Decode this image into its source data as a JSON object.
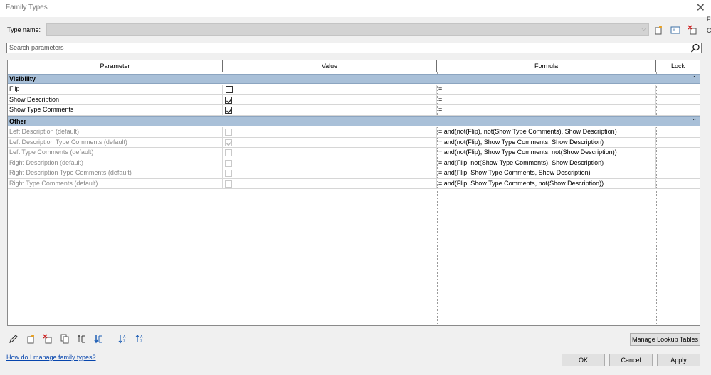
{
  "window": {
    "title": "Family Types",
    "edge_fragments": [
      "F",
      "C"
    ]
  },
  "type_name": {
    "label": "Type name:",
    "value": ""
  },
  "search": {
    "placeholder": "Search parameters"
  },
  "columns": {
    "parameter": "Parameter",
    "value": "Value",
    "formula": "Formula",
    "lock": "Lock"
  },
  "groups": [
    {
      "name": "Visibility",
      "collapse": "⌃",
      "rows": [
        {
          "param": "Flip",
          "checked": false,
          "disabled": false,
          "formula": "="
        },
        {
          "param": "Show Description",
          "checked": true,
          "disabled": false,
          "formula": "="
        },
        {
          "param": "Show Type Comments",
          "checked": true,
          "disabled": false,
          "formula": "="
        }
      ]
    },
    {
      "name": "Other",
      "collapse": "⌃",
      "rows": [
        {
          "param": "Left Description (default)",
          "checked": false,
          "disabled": true,
          "formula": "= and(not(Flip), not(Show Type Comments), Show Description)"
        },
        {
          "param": "Left Description Type Comments (default)",
          "checked": true,
          "disabled": true,
          "formula": "= and(not(Flip), Show Type Comments, Show Description)"
        },
        {
          "param": "Left Type Comments (default)",
          "checked": false,
          "disabled": true,
          "formula": "= and(not(Flip), Show Type Comments, not(Show Description))"
        },
        {
          "param": "Right Description (default)",
          "checked": false,
          "disabled": true,
          "formula": "= and(Flip, not(Show Type Comments), Show Description)"
        },
        {
          "param": "Right Description Type Comments (default)",
          "checked": false,
          "disabled": true,
          "formula": "= and(Flip, Show Type Comments, Show Description)"
        },
        {
          "param": "Right Type Comments (default)",
          "checked": false,
          "disabled": true,
          "formula": "= and(Flip, Show Type Comments, not(Show Description))"
        }
      ]
    }
  ],
  "buttons": {
    "manage_lookup": "Manage Lookup Tables",
    "ok": "OK",
    "cancel": "Cancel",
    "apply": "Apply"
  },
  "help_link": "How do I manage family types?",
  "colors": {
    "group_header": "#a9c0d8",
    "link": "#0645ad",
    "dialog_bg": "#f0f0f0"
  }
}
